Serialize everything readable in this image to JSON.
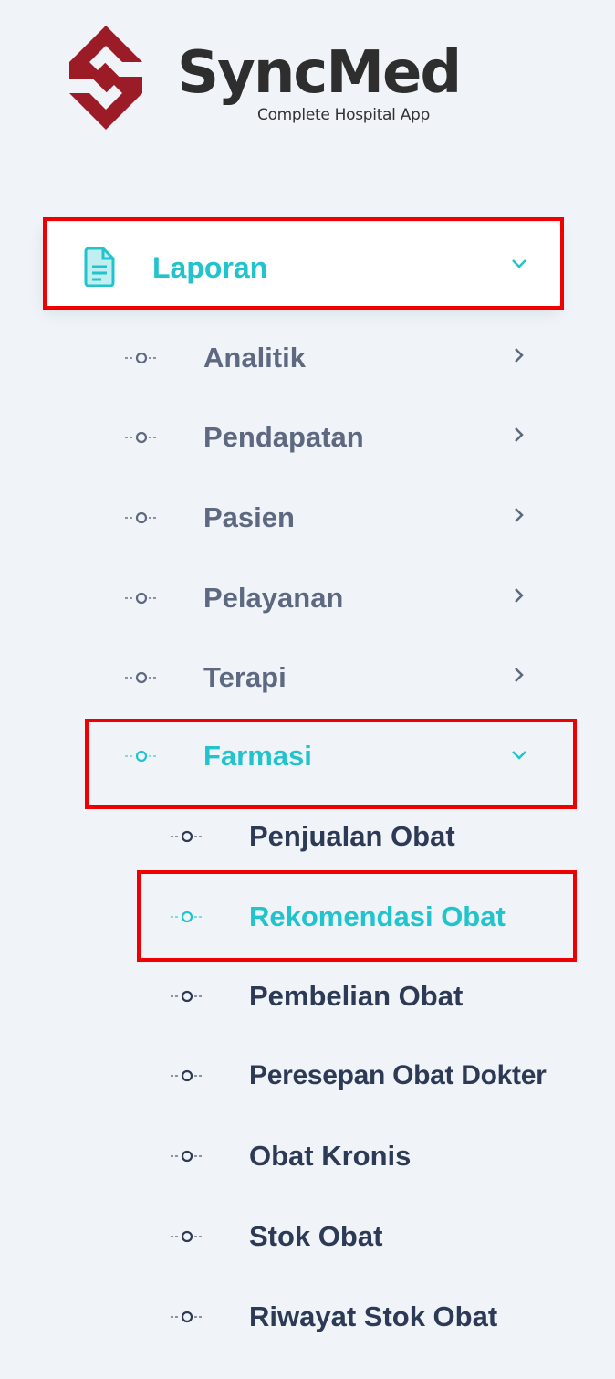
{
  "brand": {
    "name": "SyncMed",
    "tagline": "Complete Hospital App",
    "logo_icon": "syncmed-logo-icon",
    "colors": {
      "logo": "#9b1b26",
      "text": "#2e2e2e"
    }
  },
  "menu": {
    "section_label": "Laporan",
    "section_icon": "document-icon",
    "expanded": true,
    "accent": "#21c3cc",
    "items": [
      {
        "label": "Analitik",
        "expanded": false
      },
      {
        "label": "Pendapatan",
        "expanded": false
      },
      {
        "label": "Pasien",
        "expanded": false
      },
      {
        "label": "Pelayanan",
        "expanded": false
      },
      {
        "label": "Terapi",
        "expanded": false
      },
      {
        "label": "Farmasi",
        "expanded": true,
        "active": true
      }
    ],
    "subitems": [
      {
        "label": "Penjualan Obat"
      },
      {
        "label": "Rekomendasi Obat",
        "active": true
      },
      {
        "label": "Pembelian Obat"
      },
      {
        "label": "Peresepan Obat Dokter"
      },
      {
        "label": "Obat Kronis"
      },
      {
        "label": "Stok Obat"
      },
      {
        "label": "Riwayat Stok Obat"
      }
    ]
  },
  "highlight_color": "#ee0000"
}
